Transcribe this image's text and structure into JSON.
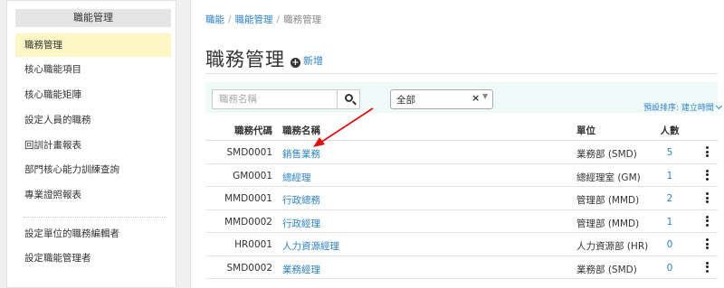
{
  "sidebar": {
    "title": "職能管理",
    "items": [
      {
        "label": "職務管理",
        "active": true
      },
      {
        "label": "核心職能項目"
      },
      {
        "label": "核心職能矩陣"
      },
      {
        "label": "設定人員的職務"
      },
      {
        "label": "回訓計畫報表"
      },
      {
        "label": "部門核心能力訓練查詢"
      },
      {
        "label": "專業證照報表"
      },
      {
        "label": "設定單位的職務編輯者"
      },
      {
        "label": "設定職能管理者"
      }
    ]
  },
  "breadcrumb": [
    "職能",
    "職能管理",
    "職務管理"
  ],
  "page": {
    "title": "職務管理",
    "add_label": "新增"
  },
  "filters": {
    "search_placeholder": "職務名稱",
    "select_value": "全部",
    "select_clear": "×",
    "sort_label": "預設排序: 建立時間"
  },
  "table": {
    "headers": {
      "code": "職務代碼",
      "name": "職務名稱",
      "unit": "單位",
      "count": "人數"
    },
    "rows": [
      {
        "code": "SMD0001",
        "name": "銷售業務",
        "unit": "業務部 (SMD)",
        "count": "5"
      },
      {
        "code": "GM0001",
        "name": "總經理",
        "unit": "總經理室 (GM)",
        "count": "1"
      },
      {
        "code": "MMD0001",
        "name": "行政總務",
        "unit": "管理部 (MMD)",
        "count": "2"
      },
      {
        "code": "MMD0002",
        "name": "行政經理",
        "unit": "管理部 (MMD)",
        "count": "1"
      },
      {
        "code": "HR0001",
        "name": "人力資源經理",
        "unit": "人力資源部 (HR)",
        "count": "0"
      },
      {
        "code": "SMD0002",
        "name": "業務經理",
        "unit": "業務部 (SMD)",
        "count": "0"
      }
    ]
  },
  "icons": {
    "add": "plus-circle-icon",
    "search": "search-icon",
    "sort": "chevron-down-icon",
    "row_menu": "kebab-menu-icon",
    "annotation": "red-arrow"
  },
  "colors": {
    "link": "#2e83c9",
    "active_bg": "#fdf7c5",
    "filter_bg": "#eef9f8",
    "arrow": "#e01010"
  }
}
